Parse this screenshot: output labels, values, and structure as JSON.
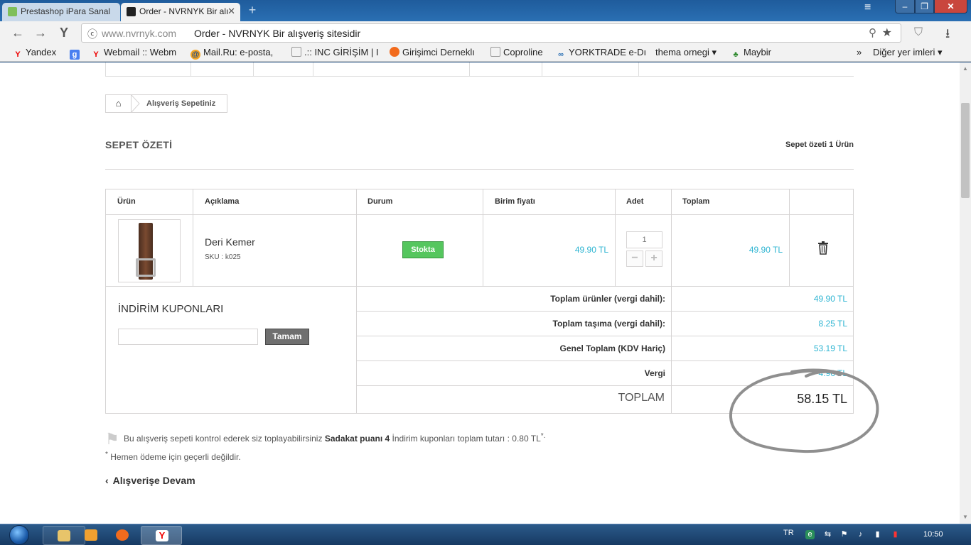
{
  "browser": {
    "tabs": [
      {
        "label": "Prestashop iPara Sanal",
        "active": false
      },
      {
        "label": "Order - NVRNYK Bir alı",
        "active": true
      }
    ],
    "url_host": "www.nvrnyk.com",
    "url_title": "Order - NVRNYK Bir alışveriş sitesidir",
    "bookmarks": [
      {
        "label": "Yandex",
        "icon": "yandex-icon"
      },
      {
        "label": "",
        "icon": "google-icon"
      },
      {
        "label": "Webmail :: Webm",
        "icon": "webmail-icon"
      },
      {
        "label": "Mail.Ru: e-posta,",
        "icon": "mailru-icon"
      },
      {
        "label": ".:: INC GİRİŞİM | I",
        "icon": "page-icon"
      },
      {
        "label": "Girişimci Derneklı",
        "icon": "dernek-icon"
      },
      {
        "label": "Coproline",
        "icon": "page-icon"
      },
      {
        "label": "YORKTRADE e-Dı",
        "icon": "yorktrade-icon"
      },
      {
        "label": "thema ornegi ▾",
        "icon": ""
      },
      {
        "label": "Maybir",
        "icon": "tree-icon"
      }
    ],
    "other_bookmarks": "Diğer yer imleri ▾"
  },
  "page": {
    "breadcrumb": {
      "current": "Alışveriş Sepetiniz"
    },
    "heading": "SEPET ÖZETİ",
    "summary_prefix": "Sepet özeti ",
    "summary_count": "1",
    "summary_suffix": " Ürün",
    "table": {
      "headers": [
        "Ürün",
        "Açıklama",
        "Durum",
        "Birim fiyatı",
        "Adet",
        "Toplam"
      ],
      "row": {
        "name": "Deri Kemer",
        "sku": "SKU : k025",
        "status": "Stokta",
        "unit_price": "49.90 TL",
        "quantity": "1",
        "total": "49.90 TL"
      }
    },
    "coupon": {
      "title": "İNDİRİM KUPONLARI",
      "button": "Tamam",
      "value": ""
    },
    "totals": [
      {
        "label": "Toplam ürünler (vergi dahil):",
        "value": "49.90 TL"
      },
      {
        "label": "Toplam taşıma (vergi dahil):",
        "value": "8.25 TL"
      },
      {
        "label": "Genel Toplam (KDV Hariç)",
        "value": "53.19 TL"
      },
      {
        "label": "Vergi",
        "value": "4.96 TL"
      }
    ],
    "grand_total_label": "TOPLAM",
    "grand_total_value": "58.15 TL",
    "loyalty": {
      "text1": "Bu alışveriş sepeti kontrol ederek siz toplayabilirsiniz",
      "points_label": "Sadakat puanı 4",
      "text2": "İndirim kuponları toplam tutarı : 0.80 TL",
      "asterisk": "*.",
      "note_mark": "*",
      "note": " Hemen ödeme için geçerli değildir."
    },
    "continue_link": "Alışverişe Devam"
  },
  "taskbar": {
    "language": "TR",
    "clock": "10:50"
  },
  "colors": {
    "accent_price": "#2fb5d2",
    "stock_green": "#55c65e",
    "button_gray": "#6f6f6f"
  }
}
